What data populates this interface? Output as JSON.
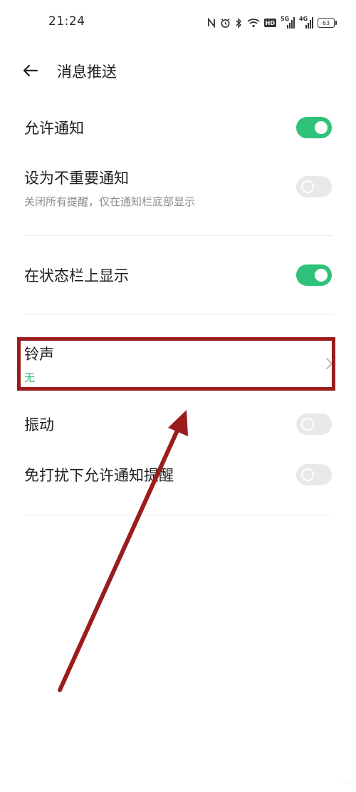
{
  "status_bar": {
    "time": "21:24",
    "signal_5g": "5G",
    "signal_4g": "4G",
    "hd": "HD",
    "battery": "63"
  },
  "header": {
    "title": "消息推送"
  },
  "settings": {
    "allow_notifications": {
      "label": "允许通知",
      "enabled": true
    },
    "unimportant": {
      "label": "设为不重要通知",
      "description": "关闭所有提醒，仅在通知栏底部显示",
      "enabled": false
    },
    "status_bar_display": {
      "label": "在状态栏上显示",
      "enabled": true
    },
    "ringtone": {
      "label": "铃声",
      "value": "无"
    },
    "vibration": {
      "label": "振动",
      "enabled": false
    },
    "dnd_allow": {
      "label": "免打扰下允许通知提醒",
      "enabled": false
    }
  },
  "colors": {
    "toggle_on": "#2ec27a",
    "toggle_off": "#e9e9e9",
    "annotation": "#9b1c1c",
    "value_text": "#2eb872"
  }
}
